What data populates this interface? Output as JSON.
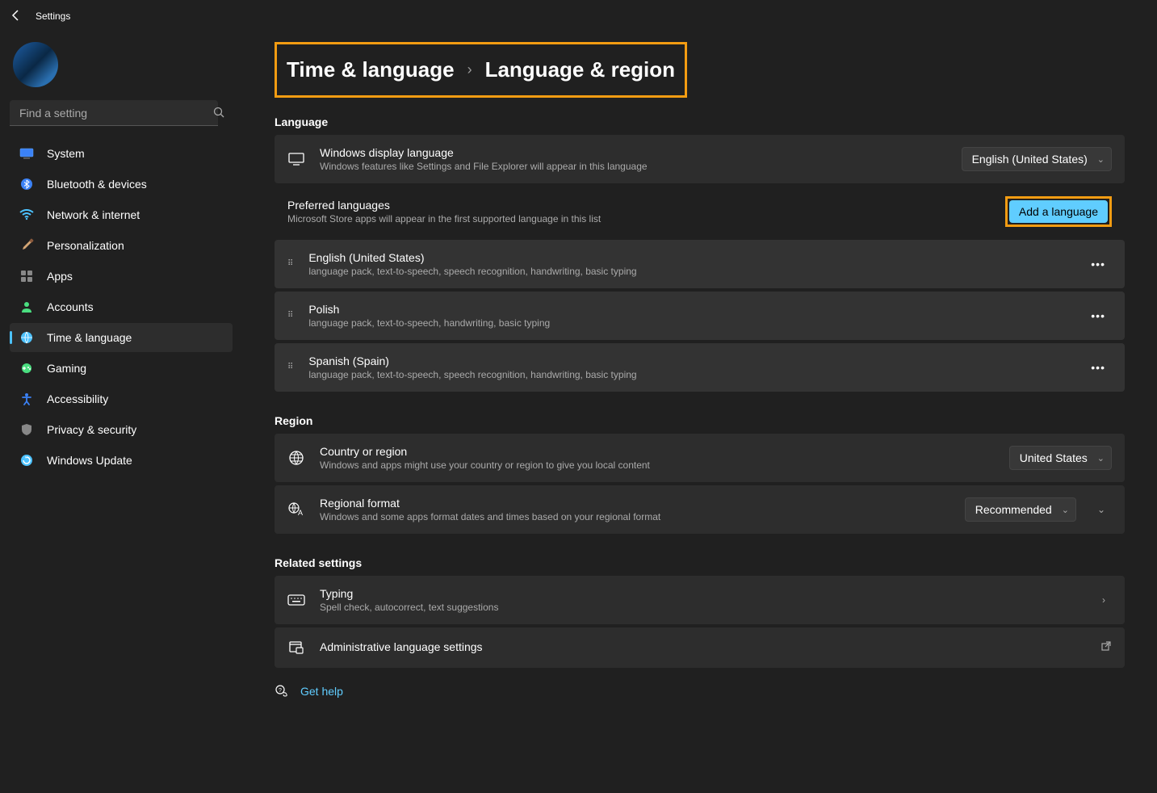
{
  "titlebar": {
    "app_title": "Settings"
  },
  "search": {
    "placeholder": "Find a setting"
  },
  "sidebar": {
    "items": [
      {
        "label": "System",
        "active": false
      },
      {
        "label": "Bluetooth & devices",
        "active": false
      },
      {
        "label": "Network & internet",
        "active": false
      },
      {
        "label": "Personalization",
        "active": false
      },
      {
        "label": "Apps",
        "active": false
      },
      {
        "label": "Accounts",
        "active": false
      },
      {
        "label": "Time & language",
        "active": true
      },
      {
        "label": "Gaming",
        "active": false
      },
      {
        "label": "Accessibility",
        "active": false
      },
      {
        "label": "Privacy & security",
        "active": false
      },
      {
        "label": "Windows Update",
        "active": false
      }
    ]
  },
  "breadcrumb": {
    "parent": "Time & language",
    "current": "Language & region"
  },
  "sections": {
    "language": {
      "header": "Language",
      "display_language": {
        "title": "Windows display language",
        "desc": "Windows features like Settings and File Explorer will appear in this language",
        "value": "English (United States)"
      },
      "preferred": {
        "title": "Preferred languages",
        "desc": "Microsoft Store apps will appear in the first supported language in this list",
        "add_button": "Add a language",
        "items": [
          {
            "name": "English (United States)",
            "features": "language pack, text-to-speech, speech recognition, handwriting, basic typing"
          },
          {
            "name": "Polish",
            "features": "language pack, text-to-speech, handwriting, basic typing"
          },
          {
            "name": "Spanish (Spain)",
            "features": "language pack, text-to-speech, speech recognition, handwriting, basic typing"
          }
        ]
      }
    },
    "region": {
      "header": "Region",
      "country": {
        "title": "Country or region",
        "desc": "Windows and apps might use your country or region to give you local content",
        "value": "United States"
      },
      "format": {
        "title": "Regional format",
        "desc": "Windows and some apps format dates and times based on your regional format",
        "value": "Recommended"
      }
    },
    "related": {
      "header": "Related settings",
      "typing": {
        "title": "Typing",
        "desc": "Spell check, autocorrect, text suggestions"
      },
      "admin": {
        "title": "Administrative language settings"
      }
    }
  },
  "help": {
    "label": "Get help"
  }
}
